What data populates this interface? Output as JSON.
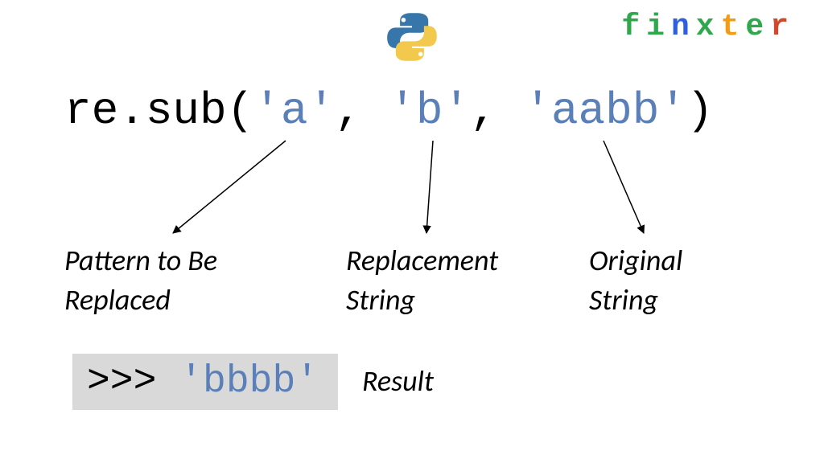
{
  "brand": {
    "letters": [
      "f",
      "i",
      "n",
      "x",
      "t",
      "e",
      "r"
    ],
    "colors": [
      "#2fa84c",
      "#2fa84c",
      "#2f5fe0",
      "#2fa84c",
      "#f39c12",
      "#2fa84c",
      "#d04a2a"
    ]
  },
  "code": {
    "func": "re.sub",
    "open": "(",
    "arg1": "'a'",
    "sep": ", ",
    "arg2": "'b'",
    "arg3": "'aabb'",
    "close": ")"
  },
  "annotations": {
    "arg1_line1": "Pattern to Be",
    "arg1_line2": "Replaced",
    "arg2_line1": "Replacement",
    "arg2_line2": "String",
    "arg3_line1": "Original",
    "arg3_line2": "String"
  },
  "result": {
    "prompt": ">>> ",
    "value": "'bbbb'",
    "label": "Result"
  }
}
